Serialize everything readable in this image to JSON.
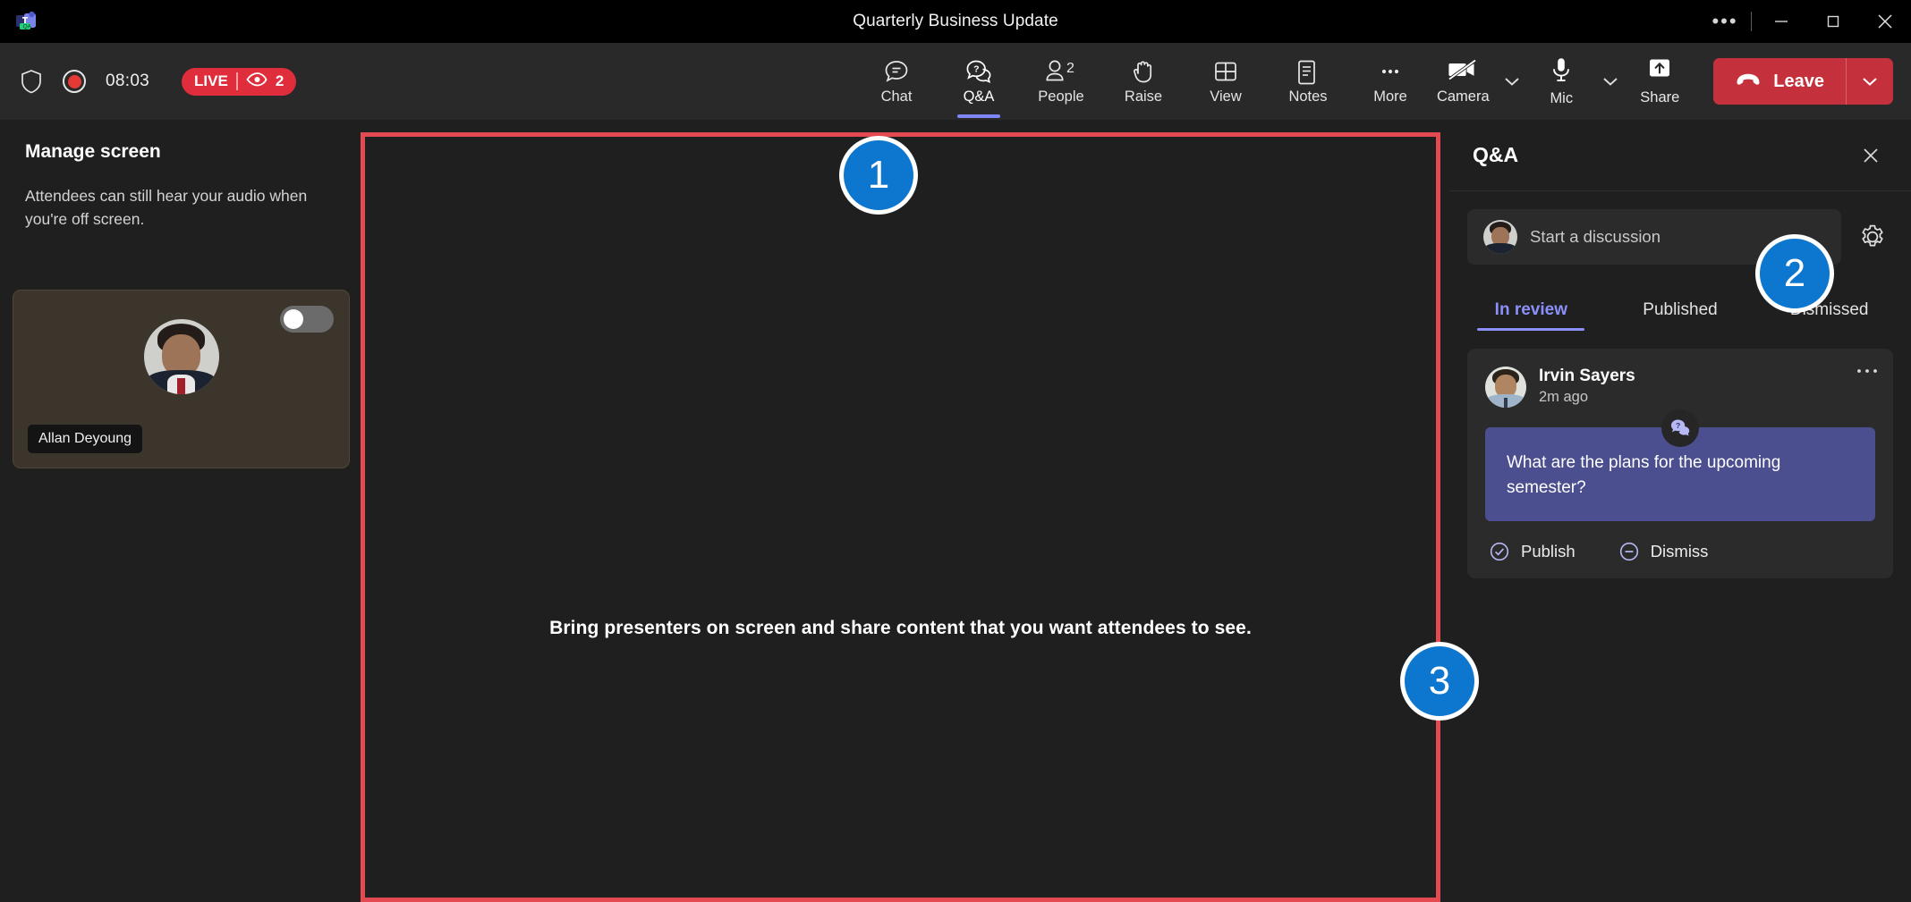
{
  "titlebar": {
    "app_icon": "teams-logo",
    "title": "Quarterly Business Update",
    "overflow_label": "•••",
    "minimize_label": "─",
    "maximize_label": "☐",
    "close_label": "✕"
  },
  "toolbar": {
    "shield_icon": "shield-icon",
    "record_icon": "record-icon",
    "timer": "08:03",
    "live_label": "LIVE",
    "viewer_icon": "eye-icon",
    "viewer_count": "2",
    "items": [
      {
        "label": "Chat",
        "icon": "chat-bubble-icon",
        "active": false,
        "count": ""
      },
      {
        "label": "Q&A",
        "icon": "question-bubble-icon",
        "active": true,
        "count": ""
      },
      {
        "label": "People",
        "icon": "person-icon",
        "active": false,
        "count": "2"
      },
      {
        "label": "Raise",
        "icon": "raise-hand-icon",
        "active": false,
        "count": ""
      },
      {
        "label": "View",
        "icon": "grid-view-icon",
        "active": false,
        "count": ""
      },
      {
        "label": "Notes",
        "icon": "notes-icon",
        "active": false,
        "count": ""
      },
      {
        "label": "More",
        "icon": "more-horizontal-icon",
        "active": false,
        "count": ""
      }
    ],
    "camera_label": "Camera",
    "camera_icon": "camera-off-icon",
    "camera_chevron": "chevron-down-icon",
    "mic_label": "Mic",
    "mic_icon": "microphone-icon",
    "mic_chevron": "chevron-down-icon",
    "share_label": "Share",
    "share_icon": "share-screen-icon",
    "leave_label": "Leave",
    "leave_icon": "hangup-phone-icon",
    "leave_chevron": "chevron-down-icon"
  },
  "manage_screen": {
    "title": "Manage screen",
    "description": "Attendees can still hear your audio when you're off screen.",
    "participant": {
      "name": "Allan Deyoung",
      "toggle_state": "off"
    }
  },
  "stage": {
    "message": "Bring presenters on screen and share content that you want attendees to see.",
    "border_color": "#e34a52"
  },
  "qa_panel": {
    "title": "Q&A",
    "close_icon": "close-icon",
    "compose_placeholder": "Start a discussion",
    "settings_icon": "gear-icon",
    "tabs": [
      {
        "label": "In review",
        "active": true
      },
      {
        "label": "Published",
        "active": false
      },
      {
        "label": "Dismissed",
        "active": false
      }
    ],
    "questions": [
      {
        "author": "Irvin Sayers",
        "time": "2m ago",
        "more_icon": "more-horizontal-icon",
        "badge_icon": "question-bubble-icon",
        "text": "What are the plans for the upcoming semester?",
        "publish_label": "Publish",
        "publish_icon": "check-circle-icon",
        "dismiss_label": "Dismiss",
        "dismiss_icon": "minus-circle-icon"
      }
    ]
  },
  "callouts": [
    {
      "number": "1"
    },
    {
      "number": "2"
    },
    {
      "number": "3"
    }
  ],
  "colors": {
    "accent_purple": "#8b90f8",
    "live_red": "#e02d3c",
    "leave_red": "#c4313c",
    "callout_blue": "#0d77cf",
    "bubble_purple": "#4b4e8f"
  }
}
